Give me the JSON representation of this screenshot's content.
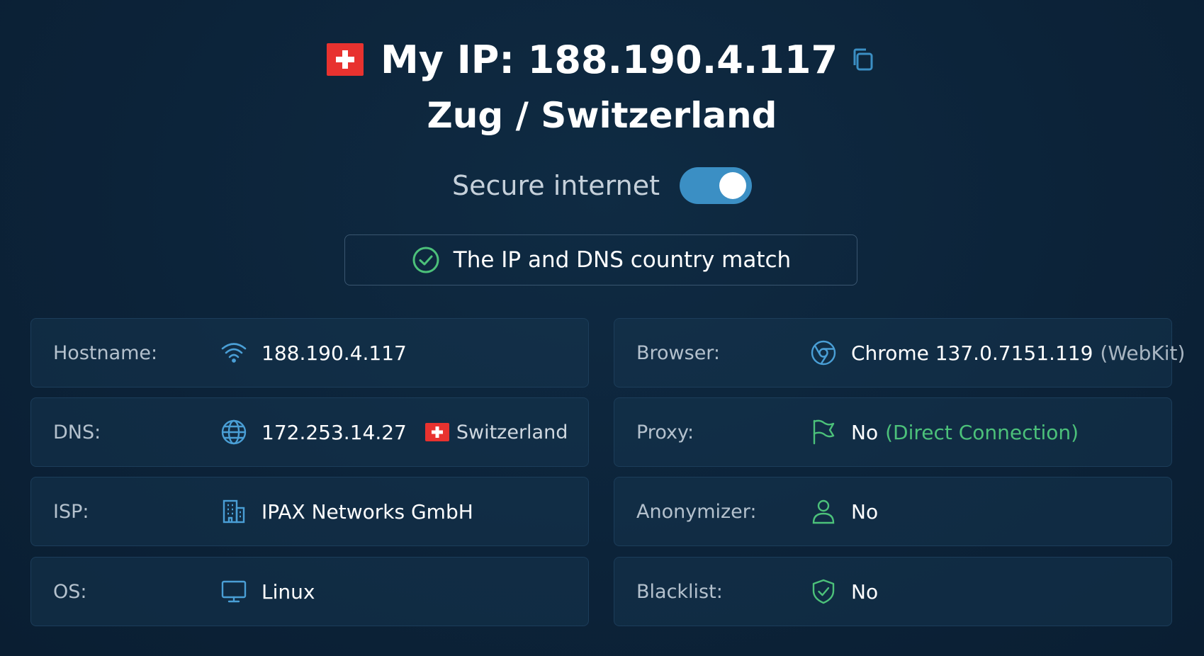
{
  "header": {
    "ip_title": "My IP: 188.190.4.117",
    "location": "Zug / Switzerland",
    "secure_label": "Secure internet",
    "secure_enabled": true,
    "match_message": "The IP and DNS country match"
  },
  "colors": {
    "accent": "#3b8fc4",
    "success": "#4cc17a",
    "flag_red": "#e8322f",
    "background": "#0c2339"
  },
  "left_cards": [
    {
      "label": "Hostname:",
      "icon": "wifi-icon",
      "value": "188.190.4.117"
    },
    {
      "label": "DNS:",
      "icon": "globe-icon",
      "value": "172.253.14.27",
      "country": "Switzerland"
    },
    {
      "label": "ISP:",
      "icon": "building-icon",
      "value": "IPAX Networks GmbH"
    },
    {
      "label": "OS:",
      "icon": "monitor-icon",
      "value": "Linux"
    }
  ],
  "right_cards": [
    {
      "label": "Browser:",
      "icon": "browser-icon",
      "value": "Chrome 137.0.7151.119",
      "extra": "(WebKit)"
    },
    {
      "label": "Proxy:",
      "icon": "flag-icon",
      "value": "No",
      "extra": "(Direct Connection)"
    },
    {
      "label": "Anonymizer:",
      "icon": "user-icon",
      "value": "No"
    },
    {
      "label": "Blacklist:",
      "icon": "shield-check-icon",
      "value": "No"
    }
  ]
}
